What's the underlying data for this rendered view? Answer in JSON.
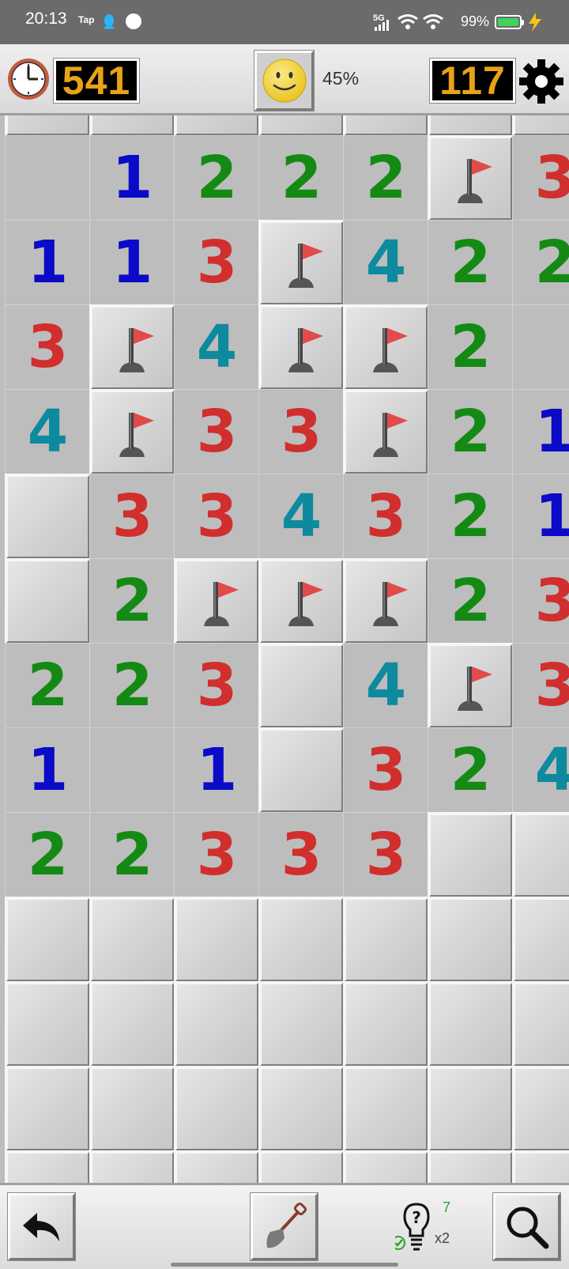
{
  "status_bar": {
    "time": "20:13",
    "tap_label": "Tap",
    "network": "5G",
    "battery_percent": "99%",
    "icons": [
      "qq-icon",
      "message-icon",
      "signal-icon",
      "wifi-icon",
      "battery-icon",
      "charging-icon"
    ]
  },
  "top_bar": {
    "timer": "541",
    "progress": "45%",
    "mines_remaining": "117",
    "icons": [
      "clock-icon",
      "smiley-face-icon",
      "gear-icon"
    ]
  },
  "board": {
    "colors": {
      "1": "#0a0ac8",
      "2": "#148a14",
      "3": "#d12e2e",
      "4": "#0e8a9e"
    },
    "legend": "C = covered, F = flag, . = open empty, digits = revealed numbers",
    "rows": [
      [
        "C",
        "C",
        "C",
        "C",
        "C",
        "C",
        "C"
      ],
      [
        ".",
        "1",
        "2",
        "2",
        "2",
        "F",
        "3"
      ],
      [
        "1",
        "1",
        "3",
        "F",
        "4",
        "2",
        "2"
      ],
      [
        "3",
        "F",
        "4",
        "F",
        "F",
        "2",
        "."
      ],
      [
        "4",
        "F",
        "3",
        "3",
        "F",
        "2",
        "1"
      ],
      [
        "C",
        "3",
        "3",
        "4",
        "3",
        "2",
        "1"
      ],
      [
        "C",
        "2",
        "F",
        "F",
        "F",
        "2",
        "3"
      ],
      [
        "2",
        "2",
        "3",
        "C",
        "4",
        "F",
        "3"
      ],
      [
        "1",
        ".",
        "1",
        "C",
        "3",
        "2",
        "4"
      ],
      [
        "2",
        "2",
        "3",
        "3",
        "3",
        "C",
        "C"
      ],
      [
        "C",
        "C",
        "C",
        "C",
        "C",
        "C",
        "C"
      ],
      [
        "C",
        "C",
        "C",
        "C",
        "C",
        "C",
        "C"
      ],
      [
        "C",
        "C",
        "C",
        "C",
        "C",
        "C",
        "C"
      ],
      [
        "C",
        "C",
        "C",
        "C",
        "C",
        "C",
        "C"
      ]
    ]
  },
  "bottom_bar": {
    "hint_count": "7",
    "hint_multiplier": "x2",
    "icons": [
      "undo-icon",
      "shovel-icon",
      "hint-bulb-icon",
      "magnifier-icon"
    ]
  }
}
